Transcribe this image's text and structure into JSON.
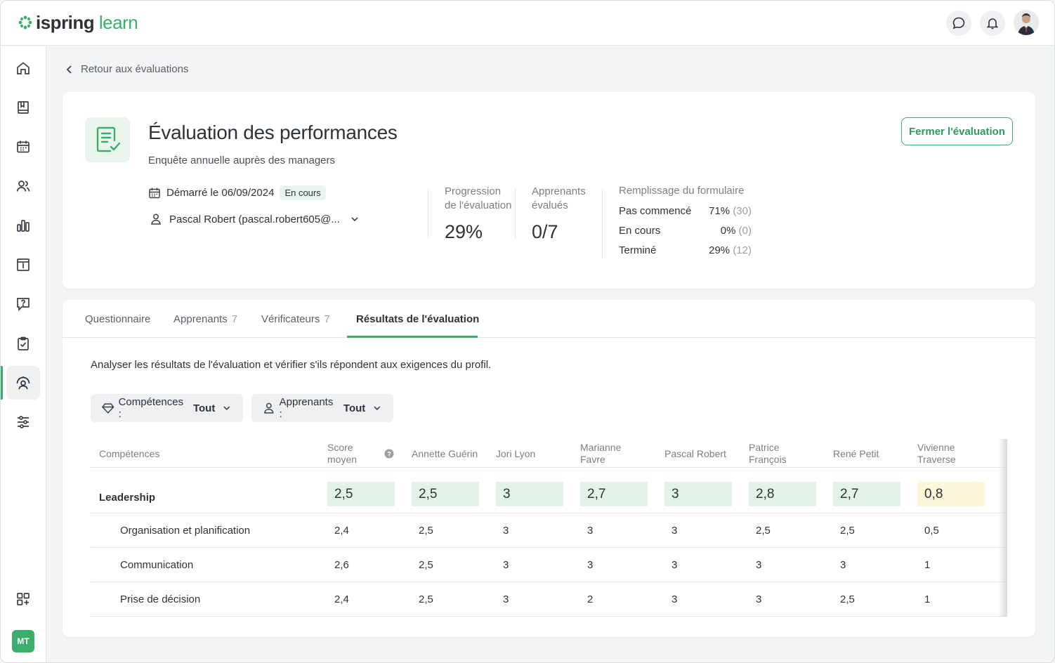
{
  "app": {
    "logo_primary": "ispring",
    "logo_secondary": "learn",
    "user_initials": "MT",
    "accent": "#3aae6a"
  },
  "header": {
    "icons": [
      "chat-icon",
      "bell-icon",
      "user-avatar"
    ]
  },
  "sidebar": {
    "items": [
      "home-icon",
      "book-icon",
      "calendar-icon",
      "users-icon",
      "chart-icon",
      "info-board-icon",
      "question-icon",
      "clipboard-check-icon",
      "assessment-icon",
      "settings-sliders-icon"
    ],
    "bottom": "apps-add-icon",
    "active_index": 8
  },
  "back_link": "Retour aux évaluations",
  "evaluation": {
    "title": "Évaluation des performances",
    "subtitle": "Enquête annuelle auprès des managers",
    "close_button": "Fermer l'évaluation",
    "started": "Démarré le 06/09/2024",
    "status": "En cours",
    "owner": "Pascal Robert (pascal.robert605@...",
    "stats": {
      "progress_label_1": "Progression",
      "progress_label_2": "de l'évaluation",
      "progress_value": "29%",
      "learners_label_1": "Apprenants",
      "learners_label_2": "évalués",
      "learners_value": "0/7"
    },
    "fill": {
      "title": "Remplissage du formulaire",
      "rows": [
        {
          "label": "Pas commencé",
          "pct": "71%",
          "count": "(30)"
        },
        {
          "label": "En cours",
          "pct": "0%",
          "count": "(0)"
        },
        {
          "label": "Terminé",
          "pct": "29%",
          "count": "(12)"
        }
      ]
    }
  },
  "tabs": [
    {
      "label": "Questionnaire",
      "count": ""
    },
    {
      "label": "Apprenants",
      "count": "7"
    },
    {
      "label": "Vérificateurs",
      "count": "7"
    },
    {
      "label": "Résultats de l'évaluation",
      "count": ""
    }
  ],
  "results": {
    "intro": "Analyser les résultats de l'évaluation et vérifier s'ils répondent aux exigences du profil.",
    "filters": [
      {
        "label": "Compétences :",
        "value": "Tout"
      },
      {
        "label": "Apprenants :",
        "value": "Tout"
      }
    ],
    "columns": [
      {
        "l1": "Compétences",
        "l2": ""
      },
      {
        "l1": "Score",
        "l2": "moyen"
      },
      {
        "l1": "Annette Guérin",
        "l2": ""
      },
      {
        "l1": "Jori Lyon",
        "l2": ""
      },
      {
        "l1": "Marianne",
        "l2": "Favre"
      },
      {
        "l1": "Pascal Robert",
        "l2": ""
      },
      {
        "l1": "Patrice",
        "l2": "François"
      },
      {
        "l1": "René Petit",
        "l2": ""
      },
      {
        "l1": "Vivienne",
        "l2": "Traverse"
      }
    ],
    "group": {
      "name": "Leadership",
      "values": [
        "2,5",
        "2,5",
        "3",
        "2,7",
        "3",
        "2,8",
        "2,7",
        "0,8"
      ]
    },
    "rows": [
      {
        "name": "Organisation et planification",
        "values": [
          "2,4",
          "2,5",
          "3",
          "3",
          "3",
          "2,5",
          "2,5",
          "0,5"
        ]
      },
      {
        "name": "Communication",
        "values": [
          "2,6",
          "2,5",
          "3",
          "3",
          "3",
          "3",
          "3",
          "1"
        ]
      },
      {
        "name": "Prise de décision",
        "values": [
          "2,4",
          "2,5",
          "3",
          "2",
          "3",
          "3",
          "2,5",
          "1"
        ]
      }
    ]
  }
}
